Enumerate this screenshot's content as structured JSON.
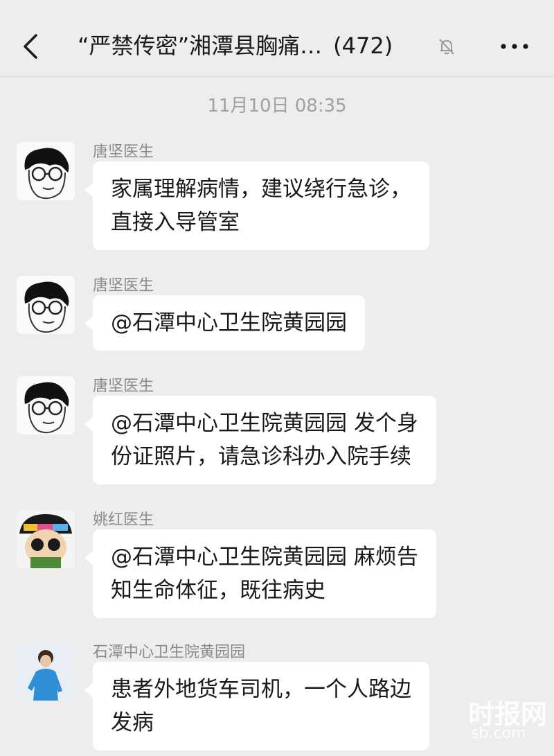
{
  "header": {
    "group_name": "“严禁传密”湘潭县胸痛…",
    "member_count": "(472)"
  },
  "timestamp": "11月10日 08:35",
  "messages": [
    {
      "sender": "唐坚医生",
      "text": "家属理解病情，建议绕行急诊，\n直接入导管室",
      "avatar": "cartoon-glasses-man-avatar"
    },
    {
      "sender": "唐坚医生",
      "text": "@石潭中心卫生院黄园园",
      "avatar": "cartoon-glasses-man-avatar"
    },
    {
      "sender": "唐坚医生",
      "text": "@石潭中心卫生院黄园园 发个身\n份证照片，请急诊科办入院手续",
      "avatar": "cartoon-glasses-man-avatar"
    },
    {
      "sender": "姚红医生",
      "text": "@石潭中心卫生院黄园园 麻烦告\n知生命体征，既往病史",
      "avatar": "cartoon-cap-sunglasses-avatar"
    },
    {
      "sender": "石潭中心卫生院黄园园",
      "text": "患者外地货车司机，一个人路边\n发病",
      "avatar": "photo-person-blue-jacket-avatar"
    }
  ],
  "watermark": {
    "main": "时报网",
    "sub": "sb.com"
  }
}
